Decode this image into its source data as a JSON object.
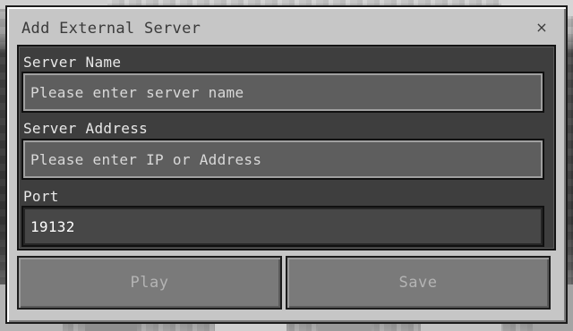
{
  "dialog": {
    "title": "Add External Server",
    "close_glyph": "×",
    "close_icon": "close-icon"
  },
  "form": {
    "server_name": {
      "label": "Server Name",
      "placeholder": "Please enter server name",
      "value": ""
    },
    "server_address": {
      "label": "Server Address",
      "placeholder": "Please enter IP or Address",
      "value": ""
    },
    "port": {
      "label": "Port",
      "placeholder": "",
      "value": "19132"
    }
  },
  "actions": {
    "play_label": "Play",
    "save_label": "Save"
  }
}
